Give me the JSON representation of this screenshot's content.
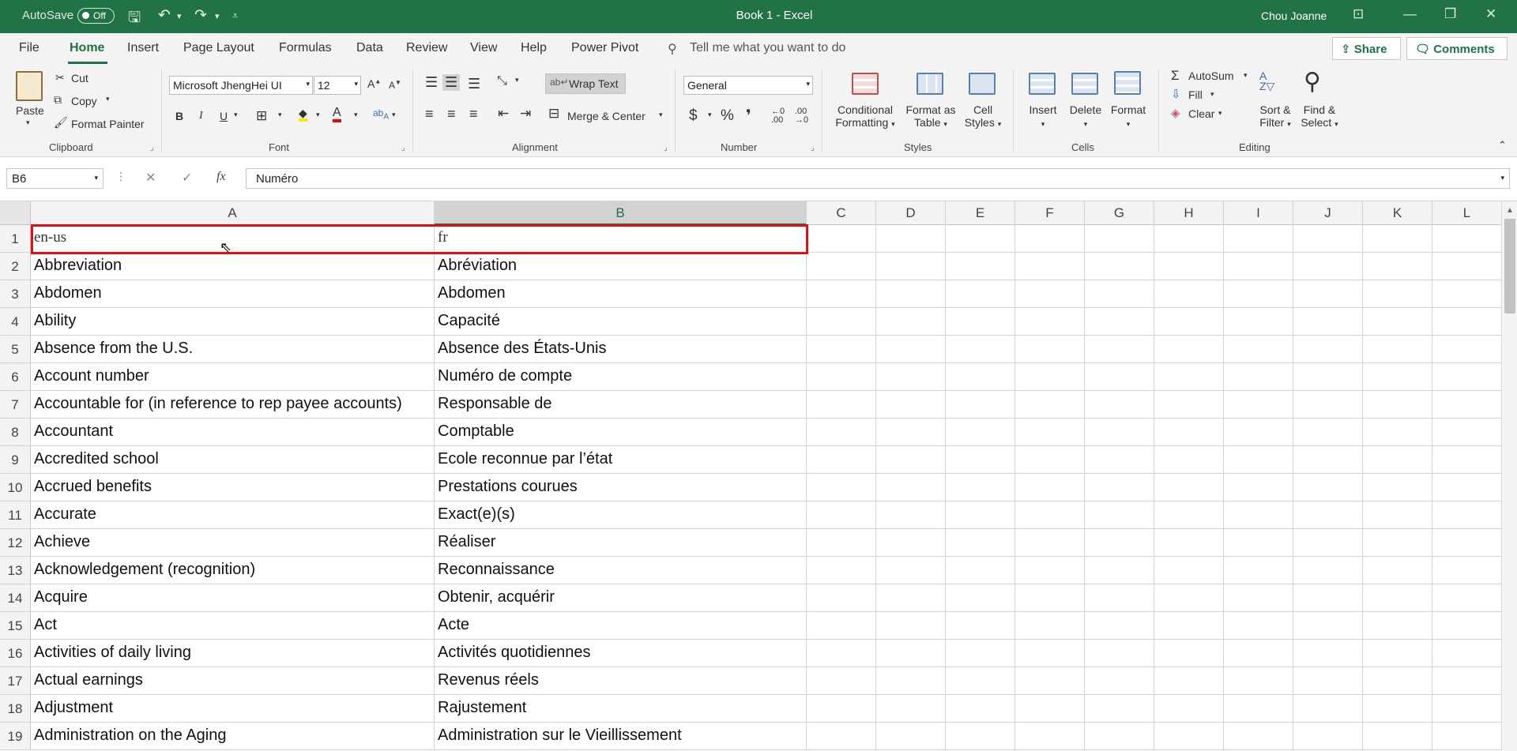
{
  "titlebar": {
    "autosave_label": "AutoSave",
    "autosave_state": "Off",
    "doc_title": "Book 1  -  Excel",
    "user": "Chou Joanne"
  },
  "menu": {
    "tabs": [
      "File",
      "Home",
      "Insert",
      "Page Layout",
      "Formulas",
      "Data",
      "Review",
      "View",
      "Help",
      "Power Pivot"
    ],
    "active": "Home",
    "tell_me": "Tell me what you want to do",
    "share": "Share",
    "comments": "Comments"
  },
  "ribbon": {
    "clipboard": {
      "paste": "Paste",
      "cut": "Cut",
      "copy": "Copy",
      "format_painter": "Format Painter",
      "label": "Clipboard"
    },
    "font": {
      "name": "Microsoft JhengHei UI",
      "size": "12",
      "label": "Font"
    },
    "alignment": {
      "wrap_text": "Wrap Text",
      "merge_center": "Merge & Center",
      "label": "Alignment"
    },
    "number": {
      "format": "General",
      "label": "Number"
    },
    "styles": {
      "conditional_1": "Conditional",
      "conditional_2": "Formatting",
      "format_table_1": "Format as",
      "format_table_2": "Table",
      "cell_styles_1": "Cell",
      "cell_styles_2": "Styles",
      "label": "Styles"
    },
    "cells": {
      "insert": "Insert",
      "delete": "Delete",
      "format": "Format",
      "label": "Cells"
    },
    "editing": {
      "autosum": "AutoSum",
      "fill": "Fill",
      "clear": "Clear",
      "sort_1": "Sort &",
      "sort_2": "Filter",
      "find_1": "Find &",
      "find_2": "Select",
      "label": "Editing"
    }
  },
  "formula_bar": {
    "name_box": "B6",
    "formula": "Numéro"
  },
  "columns": [
    "A",
    "B",
    "C",
    "D",
    "E",
    "F",
    "G",
    "H",
    "I",
    "J",
    "K",
    "L"
  ],
  "rows": [
    {
      "n": "1",
      "a": "en-us",
      "b": "fr"
    },
    {
      "n": "2",
      "a": "Abbreviation",
      "b": "Abréviation"
    },
    {
      "n": "3",
      "a": "Abdomen",
      "b": "Abdomen"
    },
    {
      "n": "4",
      "a": "Ability",
      "b": "Capacité"
    },
    {
      "n": "5",
      "a": "Absence from the U.S.",
      "b": "Absence des États-Unis"
    },
    {
      "n": "6",
      "a": "Account number",
      "b": "Numéro de compte"
    },
    {
      "n": "7",
      "a": "Accountable for (in reference to rep payee accounts)",
      "b": "Responsable de"
    },
    {
      "n": "8",
      "a": "Accountant",
      "b": "Comptable"
    },
    {
      "n": "9",
      "a": "Accredited school",
      "b": "Ecole reconnue par l’état"
    },
    {
      "n": "10",
      "a": "Accrued benefits",
      "b": "Prestations courues"
    },
    {
      "n": "11",
      "a": "Accurate",
      "b": "Exact(e)(s)"
    },
    {
      "n": "12",
      "a": "Achieve",
      "b": "Réaliser"
    },
    {
      "n": "13",
      "a": "Acknowledgement (recognition)",
      "b": "Reconnaissance"
    },
    {
      "n": "14",
      "a": "Acquire",
      "b": "Obtenir, acquérir"
    },
    {
      "n": "15",
      "a": "Act",
      "b": "Acte"
    },
    {
      "n": "16",
      "a": "Activities of daily living",
      "b": "Activités quotidiennes"
    },
    {
      "n": "17",
      "a": "Actual earnings",
      "b": "Revenus réels"
    },
    {
      "n": "18",
      "a": "Adjustment",
      "b": "Rajustement"
    },
    {
      "n": "19",
      "a": "Administration on the Aging",
      "b": "Administration sur le Vieillissement"
    }
  ]
}
